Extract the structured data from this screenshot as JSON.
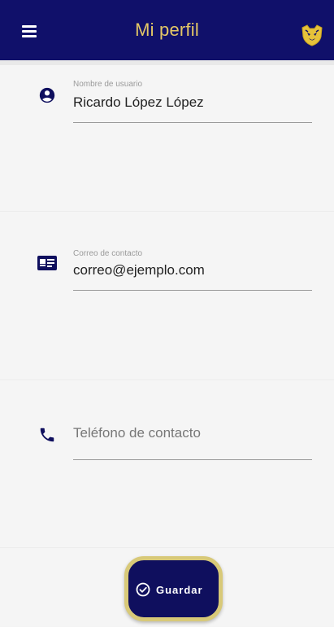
{
  "app_bar": {
    "title": "Mi perfil",
    "menu_icon": "hamburger-menu-icon",
    "logo_icon": "pumas-logo-icon",
    "background_color": "#10106a",
    "title_color": "#e3c766"
  },
  "form": {
    "username": {
      "icon": "account-circle-icon",
      "label": "Nombre de usuario",
      "value": "Ricardo López López"
    },
    "email": {
      "icon": "contact-card-icon",
      "label": "Correo de contacto",
      "value": "correo@ejemplo.com"
    },
    "phone": {
      "icon": "phone-icon",
      "placeholder": "Teléfono de contacto",
      "value": ""
    }
  },
  "save_button": {
    "label": "Guardar",
    "icon": "check-circle-icon",
    "background_color": "#0f0f5e",
    "border_color": "#d8c978"
  }
}
